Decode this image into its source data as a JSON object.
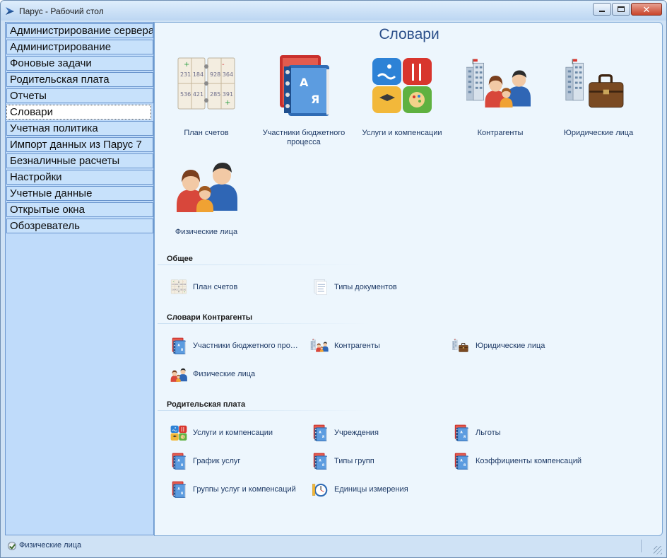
{
  "window": {
    "title": "Парус - Рабочий стол"
  },
  "sidebar": {
    "items": [
      {
        "label": "Администрирование сервера"
      },
      {
        "label": "Администрирование"
      },
      {
        "label": "Фоновые задачи"
      },
      {
        "label": "Родительская плата"
      },
      {
        "label": "Отчеты"
      },
      {
        "label": "Словари"
      },
      {
        "label": "Учетная политика"
      },
      {
        "label": "Импорт данных из Парус 7"
      },
      {
        "label": "Безналичные расчеты"
      },
      {
        "label": "Настройки"
      },
      {
        "label": "Учетные данные"
      },
      {
        "label": "Открытые окна"
      },
      {
        "label": "Обозреватель"
      }
    ],
    "active": "Словари"
  },
  "main": {
    "title": "Словари",
    "big_items": [
      {
        "label": "План счетов",
        "icon": "chart-of-accounts-icon"
      },
      {
        "label": "Участники бюджетного процесса",
        "icon": "budget-book-icon"
      },
      {
        "label": "Услуги и компенсации",
        "icon": "services-icon"
      },
      {
        "label": "Контрагенты",
        "icon": "counterparties-icon"
      },
      {
        "label": "Юридические лица",
        "icon": "legal-entities-icon"
      },
      {
        "label": "Физические лица",
        "icon": "individuals-icon"
      }
    ],
    "sections": [
      {
        "title": "Общее",
        "items": [
          {
            "label": "План счетов",
            "icon": "chart-of-accounts-icon"
          },
          {
            "label": "Типы документов",
            "icon": "document-types-icon"
          }
        ]
      },
      {
        "title": "Словари Контрагенты",
        "items": [
          {
            "label": "Участники бюджетного про…",
            "icon": "book-icon"
          },
          {
            "label": "Контрагенты",
            "icon": "counterparties-icon"
          },
          {
            "label": "Юридические лица",
            "icon": "legal-entities-icon"
          },
          {
            "label": "Физические лица",
            "icon": "individuals-icon"
          }
        ]
      },
      {
        "title": "Родительская плата",
        "items": [
          {
            "label": "Услуги и компенсации",
            "icon": "services-icon"
          },
          {
            "label": "Учреждения",
            "icon": "book-icon"
          },
          {
            "label": "Льготы",
            "icon": "book-icon"
          },
          {
            "label": "График услуг",
            "icon": "book-icon"
          },
          {
            "label": "Типы групп",
            "icon": "book-icon"
          },
          {
            "label": "Коэффициенты компенсаций",
            "icon": "book-icon"
          },
          {
            "label": "Группы услуг и компенсаций",
            "icon": "book-icon"
          },
          {
            "label": "Единицы измерения",
            "icon": "measure-units-icon"
          }
        ]
      }
    ]
  },
  "statusbar": {
    "text": "Физические лица",
    "icon": "checkmark-icon"
  },
  "colors": {
    "sidebar_bg": "#c7e1fb",
    "main_bg": "#edf6fd",
    "title": "#2b4f8a",
    "link": "#1e3a66"
  }
}
